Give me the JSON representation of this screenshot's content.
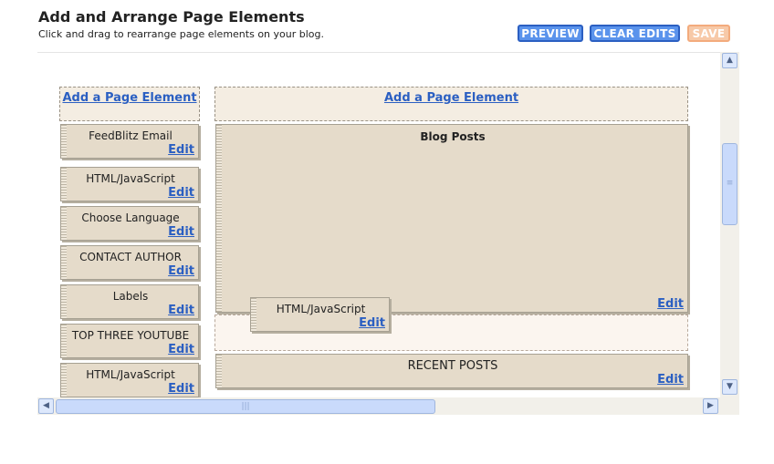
{
  "header": {
    "title": "Add and Arrange Page Elements",
    "subtitle": "Click and drag to rearrange page elements on your blog."
  },
  "toolbar": {
    "preview_label": "PREVIEW",
    "clear_label": "CLEAR EDITS",
    "save_label": "SAVE"
  },
  "layout": {
    "add_element_label": "Add a Page Element",
    "edit_label": "Edit",
    "sidebar_widgets": [
      {
        "title": "FeedBlitz Email"
      },
      {
        "title": "HTML/JavaScript"
      },
      {
        "title": "Choose Language"
      },
      {
        "title": "CONTACT AUTHOR"
      },
      {
        "title": "Labels"
      },
      {
        "title": "TOP THREE YOUTUBE"
      },
      {
        "title": "HTML/JavaScript"
      }
    ],
    "main": {
      "blog_posts_title": "Blog Posts",
      "dragging_widget_title": "HTML/JavaScript",
      "recent_posts_title": "RECENT POSTS"
    }
  },
  "icons": {
    "scroll_up": "arrow-up-icon",
    "scroll_down": "arrow-down-icon",
    "scroll_left": "arrow-left-icon",
    "scroll_right": "arrow-right-icon"
  },
  "colors": {
    "accent_blue": "#5a93ec",
    "link_blue": "#2b5fc2",
    "widget_bg": "#e5dbca",
    "save_disabled": "#f7c9a8"
  }
}
